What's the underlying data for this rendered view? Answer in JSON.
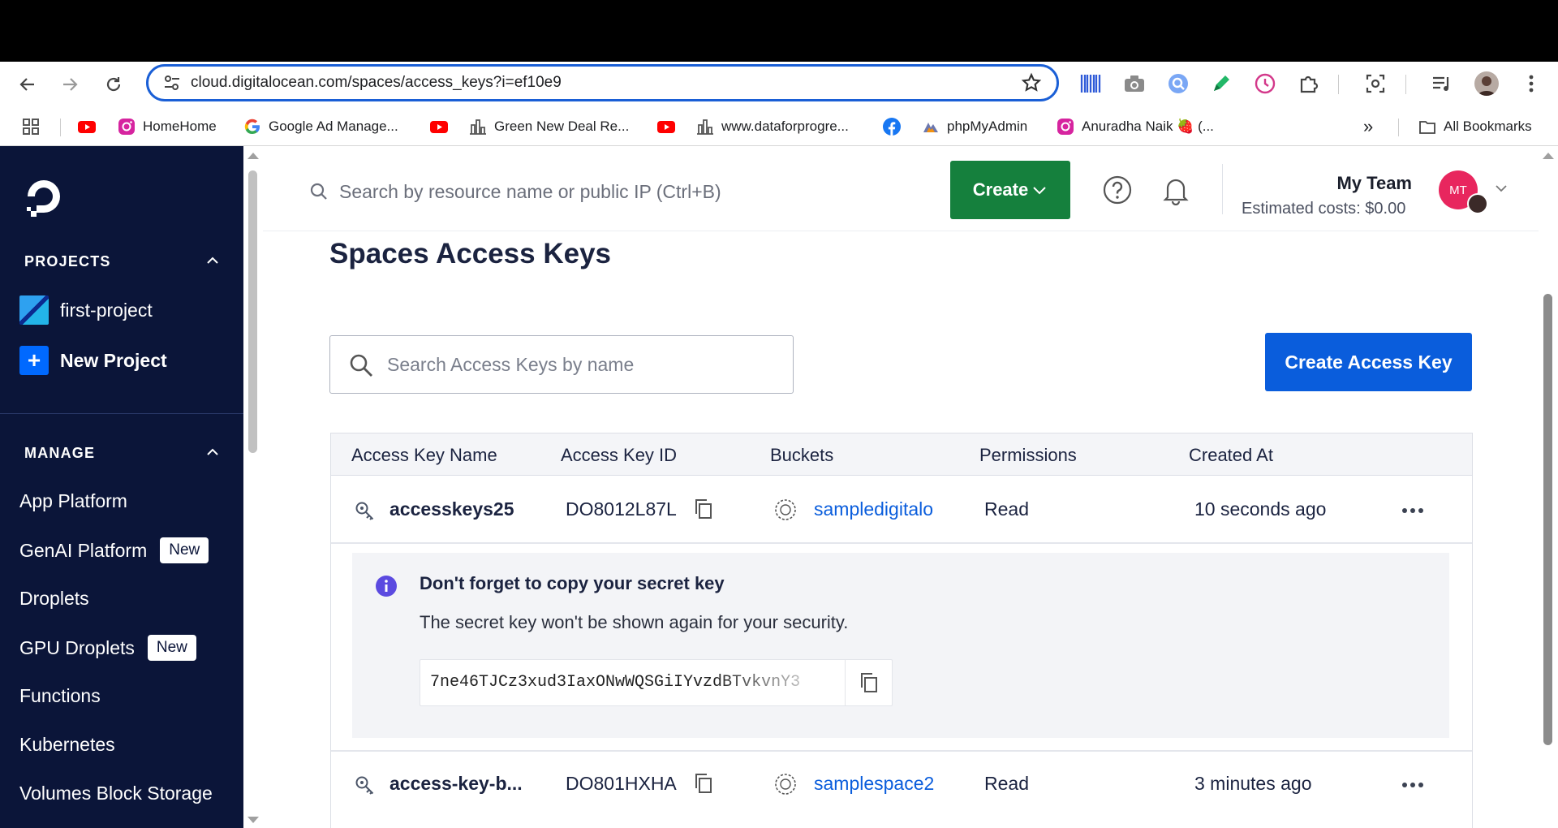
{
  "browser": {
    "url": "cloud.digitalocean.com/spaces/access_keys?i=ef10e9",
    "bookmarks": [
      {
        "label": "",
        "icon": "apps-grid-icon"
      },
      {
        "label": "",
        "icon": "youtube-icon"
      },
      {
        "label": "HomeHome",
        "icon": "instagram-icon"
      },
      {
        "label": "Google Ad Manage...",
        "icon": "google-icon"
      },
      {
        "label": "",
        "icon": "youtube-icon"
      },
      {
        "label": "Green New Deal Re...",
        "icon": "bar-chart-icon"
      },
      {
        "label": "",
        "icon": "youtube-icon"
      },
      {
        "label": "www.dataforprogre...",
        "icon": "bar-chart-icon"
      },
      {
        "label": "",
        "icon": "facebook-icon"
      },
      {
        "label": "phpMyAdmin",
        "icon": "phpmyadmin-icon"
      },
      {
        "label": "Anuradha Naik 🍓 (...",
        "icon": "instagram-icon"
      }
    ],
    "all_bookmarks": "All Bookmarks",
    "more": "»"
  },
  "sidebar": {
    "projects_heading": "PROJECTS",
    "project_name": "first-project",
    "new_project": "New Project",
    "manage_heading": "MANAGE",
    "plus": "+",
    "items": [
      {
        "label": "App Platform",
        "badge": ""
      },
      {
        "label": "GenAI Platform",
        "badge": "New"
      },
      {
        "label": "Droplets",
        "badge": ""
      },
      {
        "label": "GPU Droplets",
        "badge": "New"
      },
      {
        "label": "Functions",
        "badge": ""
      },
      {
        "label": "Kubernetes",
        "badge": ""
      },
      {
        "label": "Volumes Block Storage",
        "badge": ""
      }
    ]
  },
  "header": {
    "search_placeholder": "Search by resource name or public IP (Ctrl+B)",
    "create_label": "Create",
    "team_name": "My Team",
    "estimated_costs": "Estimated costs: $0.00",
    "avatar_initials": "MT"
  },
  "main": {
    "title": "Spaces Access Keys",
    "search_placeholder": "Search Access Keys by name",
    "create_key_label": "Create Access Key",
    "columns": [
      "Access Key Name",
      "Access Key ID",
      "Buckets",
      "Permissions",
      "Created At"
    ],
    "rows": [
      {
        "name": "accesskeys25",
        "key_id": "DO8012L87L",
        "bucket": "sampledigitalo",
        "permission": "Read",
        "created": "10 seconds ago"
      },
      {
        "name": "access-key-b...",
        "key_id": "DO801HXHA",
        "bucket": "samplespace2",
        "permission": "Read",
        "created": "3 minutes ago"
      }
    ],
    "notice": {
      "title": "Don't forget to copy your secret key",
      "text": "The secret key won't be shown again for your security.",
      "secret": "7ne46TJCz3xud3IaxONwWQSGiIYvzdBTvkvnY3"
    }
  },
  "colors": {
    "sidebar_bg": "#0b1539",
    "create_green": "#15803d",
    "primary_blue": "#0a5ddc",
    "link_blue": "#0a5ddc",
    "avatar_pink": "#e8265e"
  }
}
